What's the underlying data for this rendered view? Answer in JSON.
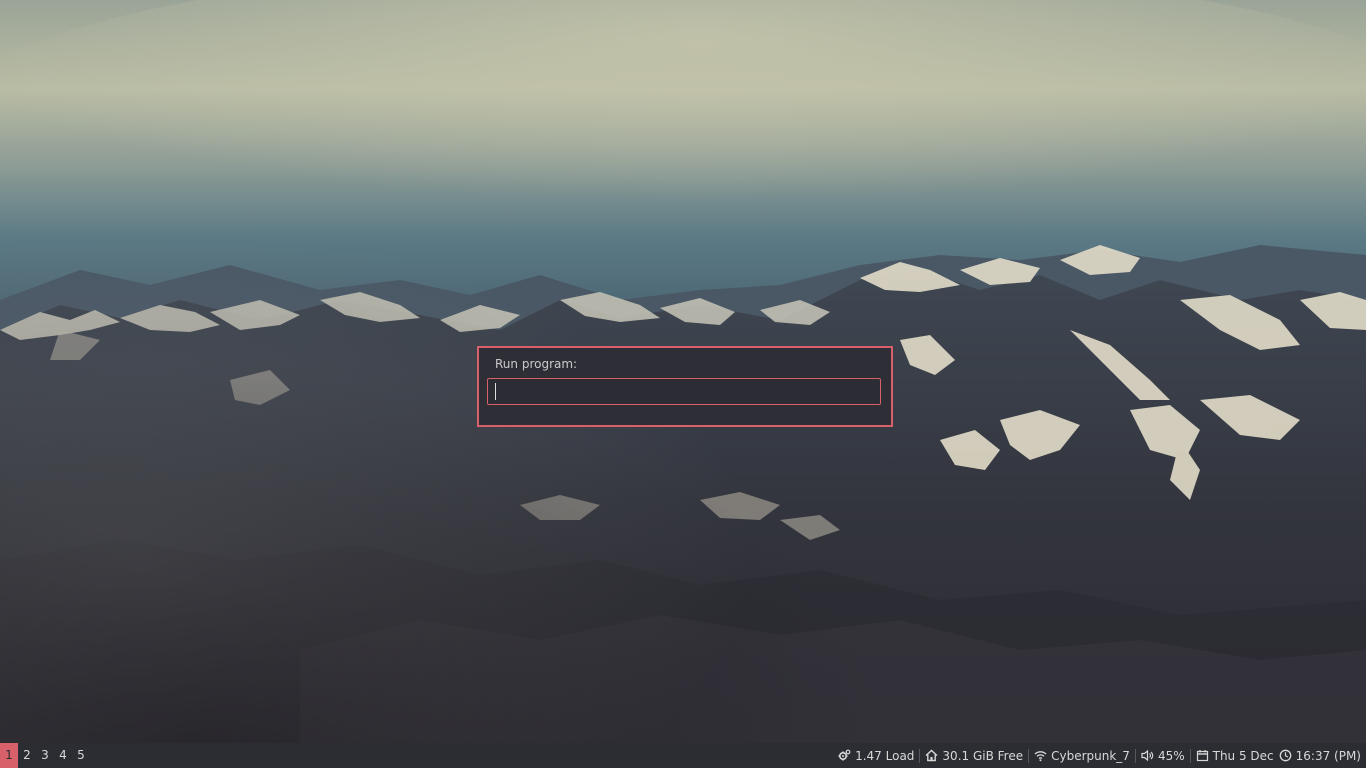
{
  "dialog": {
    "label": "Run program:",
    "input_value": ""
  },
  "workspaces": [
    "1",
    "2",
    "3",
    "4",
    "5"
  ],
  "active_workspace": "1",
  "status": {
    "load": "1.47 Load",
    "disk": "30.1 GiB Free",
    "wifi": "Cyberpunk_7",
    "volume": "45%",
    "date": "Thu 5 Dec",
    "time": "16:37 (PM)"
  },
  "icons": {
    "load": "gears-icon",
    "disk": "home-icon",
    "wifi": "wifi-icon",
    "volume": "speaker-icon",
    "date": "calendar-icon",
    "time": "clock-icon"
  },
  "colors": {
    "accent": "#d7606b",
    "bar_background": "#2b2d33",
    "dialog_background": "#2e2f36",
    "text": "#d8d8d8"
  }
}
